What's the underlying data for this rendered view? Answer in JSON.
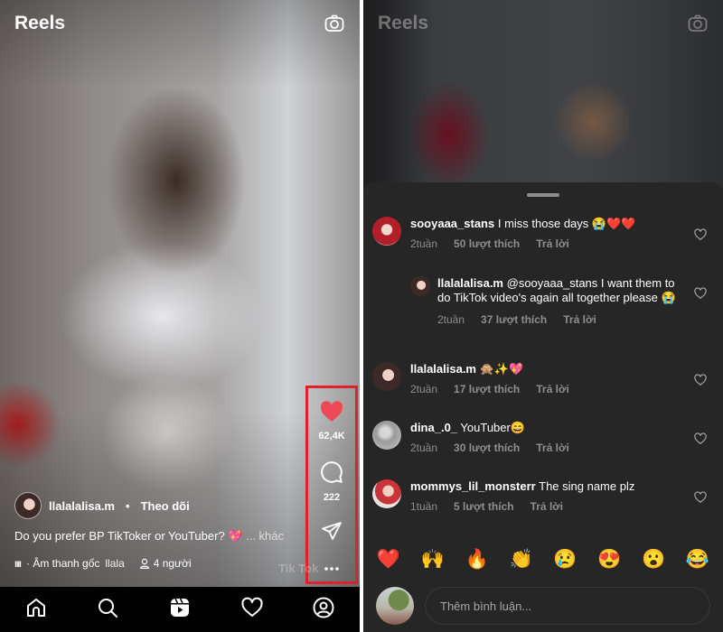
{
  "left": {
    "header": {
      "title": "Reels",
      "camera_icon": "camera-icon"
    },
    "actions": {
      "like_count": "62,4K",
      "comment_count": "222",
      "highlight_color": "#e0202a",
      "like_color": "#ed4956"
    },
    "post": {
      "author": "llalalalisa.m",
      "separator": "•",
      "follow_label": "Theo dõi",
      "caption": "Do you prefer BP TikToker or YouTuber? 💖",
      "more_label": "... khác",
      "audio_bars": "ııı",
      "audio_label": "· Âm thanh gốc",
      "audio_author": "llala",
      "people_label": "4 người"
    },
    "watermark": "Tik Tok",
    "nav": [
      "home-icon",
      "search-icon",
      "reels-icon",
      "activity-heart-icon",
      "profile-icon"
    ]
  },
  "right": {
    "header": {
      "title": "Reels"
    },
    "comments": [
      {
        "user": "sooyaaa_stans",
        "text": "I miss those days 😭❤️❤️",
        "time": "2tuần",
        "likes": "50 lượt thích",
        "reply": "Trả lời"
      },
      {
        "user": "llalalalisa.m",
        "text": "@sooyaaa_stans I want them to do TikTok video's again all together please 😭",
        "time": "2tuần",
        "likes": "37 lượt thích",
        "reply": "Trả lời"
      },
      {
        "user": "llalalalisa.m",
        "text": "🙊✨💖",
        "time": "2tuần",
        "likes": "17 lượt thích",
        "reply": "Trả lời"
      },
      {
        "user": "dina_.0_",
        "text": "YouTuber😄",
        "time": "2tuần",
        "likes": "30 lượt thích",
        "reply": "Trả lời"
      },
      {
        "user": "mommys_lil_monsterr",
        "text": "The sing name plz",
        "time": "1tuần",
        "likes": "5 lượt thích",
        "reply": "Trả lời"
      }
    ],
    "emojis": [
      "❤️",
      "🙌",
      "🔥",
      "👏",
      "😢",
      "😍",
      "😮",
      "😂"
    ],
    "input": {
      "placeholder": "Thêm bình luận..."
    }
  }
}
